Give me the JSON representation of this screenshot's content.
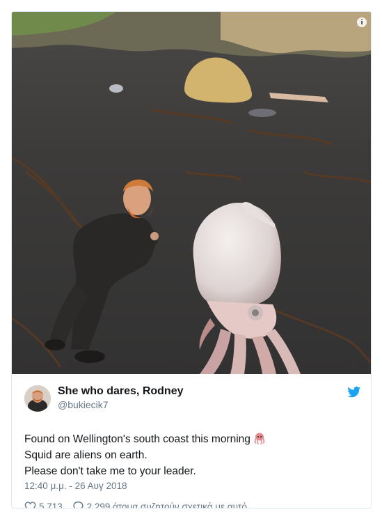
{
  "tweet": {
    "display_name": "She who dares, Rodney",
    "handle": "@bukiecik7",
    "lines": [
      "Found on Wellington's south coast this morning",
      "Squid are aliens on earth.",
      "Please don't take me to your leader."
    ],
    "emoji": "octopus-icon",
    "timestamp": "12:40 μ.μ. - 26 Αυγ 2018",
    "likes": "5.713",
    "discussion": "2.299 άτομα συζητούν σχετικά με αυτό"
  },
  "media": {
    "info_label": "i"
  },
  "colors": {
    "text": "#14171a",
    "muted": "#657786",
    "twitter_blue": "#1da1f2",
    "border": "#e1e8ed"
  },
  "icons": [
    "info-icon",
    "twitter-bird-icon",
    "heart-icon",
    "speech-bubble-icon",
    "octopus-icon"
  ]
}
